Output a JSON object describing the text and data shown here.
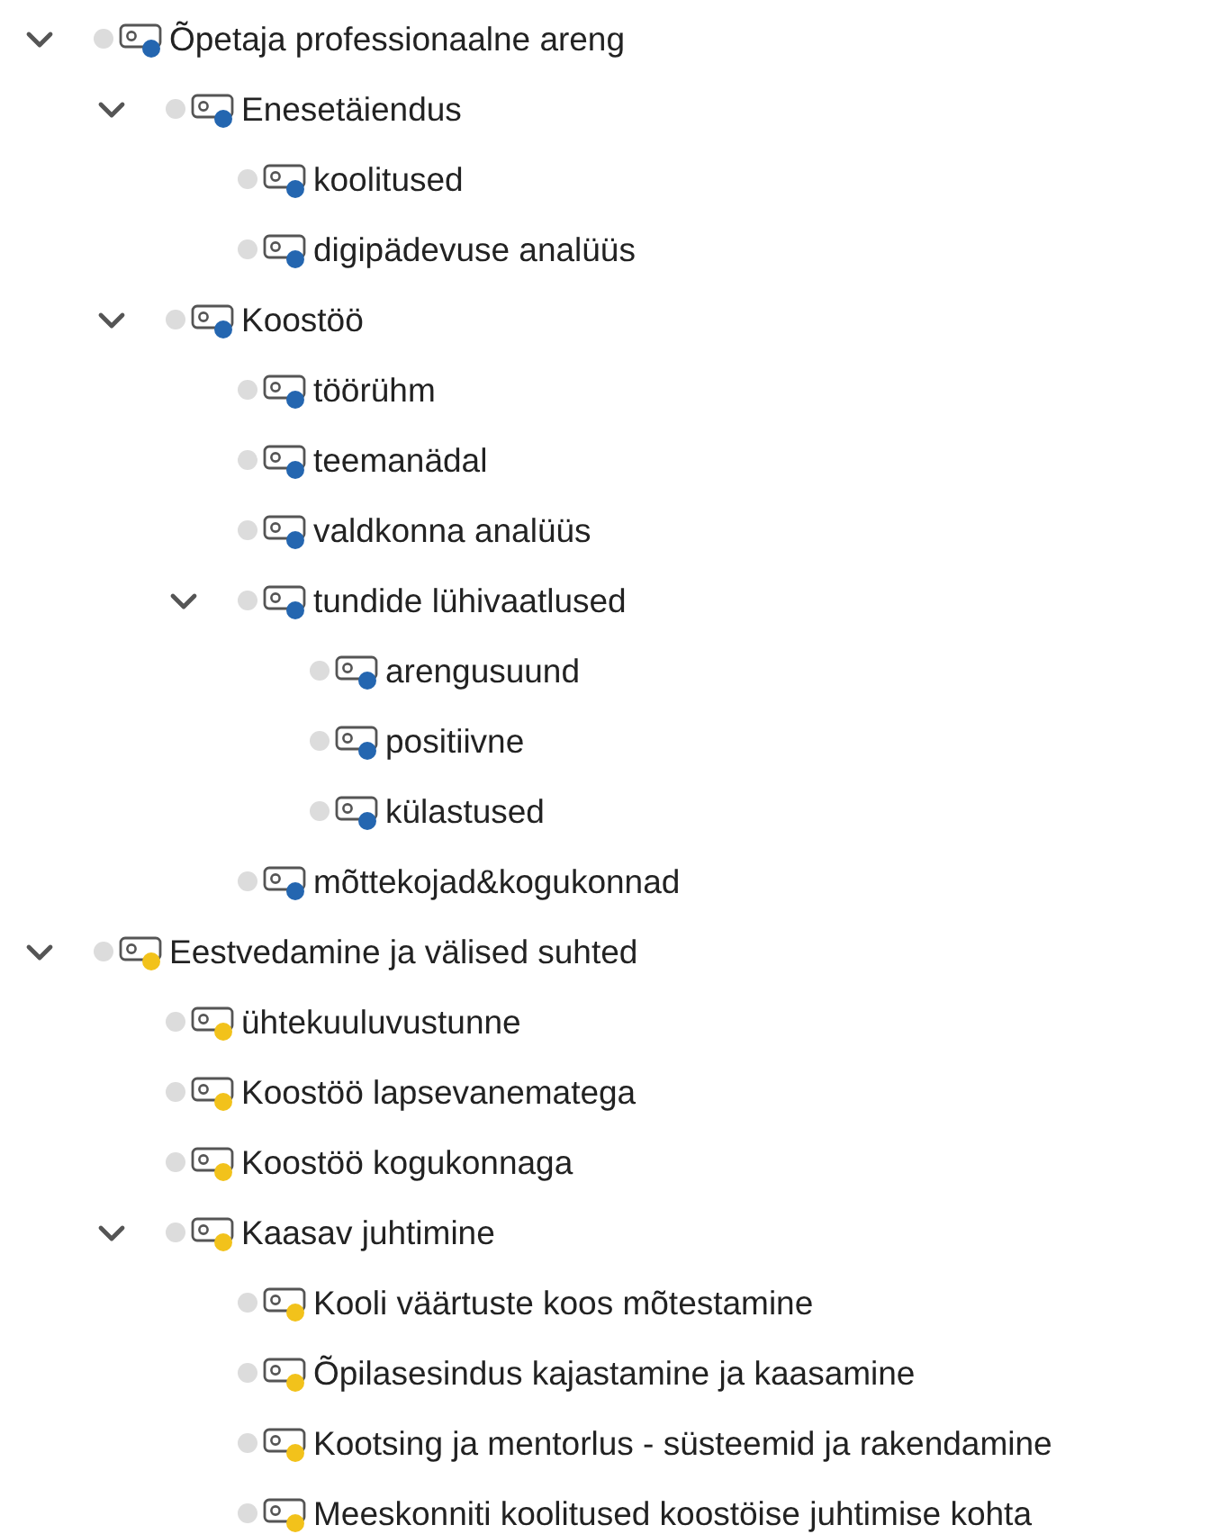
{
  "tree": [
    {
      "label": "Õpetaja professionaalne areng",
      "color": "#2466b0",
      "expanded": true,
      "children": [
        {
          "label": "Enesetäiendus",
          "color": "#2466b0",
          "expanded": true,
          "children": [
            {
              "label": "koolitused",
              "color": "#2466b0"
            },
            {
              "label": "digipädevuse analüüs",
              "color": "#2466b0"
            }
          ]
        },
        {
          "label": "Koostöö",
          "color": "#2466b0",
          "expanded": true,
          "children": [
            {
              "label": "töörühm",
              "color": "#2466b0"
            },
            {
              "label": "teemanädal",
              "color": "#2466b0"
            },
            {
              "label": "valdkonna analüüs",
              "color": "#2466b0"
            },
            {
              "label": "tundide lühivaatlused",
              "color": "#2466b0",
              "expanded": true,
              "children": [
                {
                  "label": "arengusuund",
                  "color": "#2466b0"
                },
                {
                  "label": "positiivne",
                  "color": "#2466b0"
                },
                {
                  "label": "külastused",
                  "color": "#2466b0"
                }
              ]
            },
            {
              "label": "mõttekojad&kogukonnad",
              "color": "#2466b0"
            }
          ]
        }
      ]
    },
    {
      "label": "Eestvedamine ja välised suhted",
      "color": "#f2c21b",
      "expanded": true,
      "children": [
        {
          "label": "ühtekuuluvustunne",
          "color": "#f2c21b"
        },
        {
          "label": "Koostöö lapsevanematega",
          "color": "#f2c21b"
        },
        {
          "label": "Koostöö kogukonnaga",
          "color": "#f2c21b"
        },
        {
          "label": "Kaasav juhtimine",
          "color": "#f2c21b",
          "expanded": true,
          "children": [
            {
              "label": "Kooli väärtuste koos mõtestamine",
              "color": "#f2c21b"
            },
            {
              "label": "Õpilasesindus kajastamine ja kaasamine",
              "color": "#f2c21b"
            },
            {
              "label": "Kootsing ja mentorlus - süsteemid ja rakendamine",
              "color": "#f2c21b"
            },
            {
              "label": "Meeskonniti koolitused koostöise juhtimise kohta",
              "color": "#f2c21b"
            }
          ]
        }
      ]
    }
  ]
}
